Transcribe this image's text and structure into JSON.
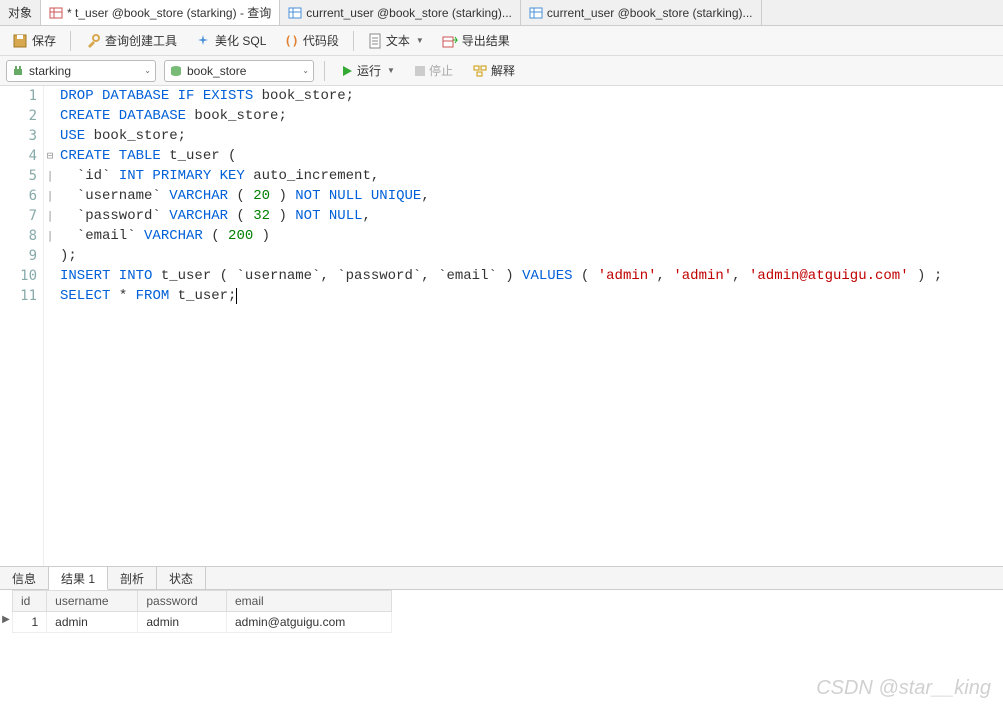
{
  "tabs": {
    "obj": "对象",
    "t0": "* t_user @book_store (starking) - 查询",
    "t1": "current_user @book_store (starking)...",
    "t2": "current_user @book_store (starking)..."
  },
  "toolbar": {
    "save": "保存",
    "query_builder": "查询创建工具",
    "beautify": "美化 SQL",
    "snippet": "代码段",
    "text": "文本",
    "export": "导出结果"
  },
  "combos": {
    "connection": "starking",
    "database": "book_store"
  },
  "run": {
    "run": "运行",
    "stop": "停止",
    "explain": "解释"
  },
  "code": {
    "lines": [
      {
        "n": "1",
        "t": [
          [
            "kw",
            "DROP DATABASE IF EXISTS"
          ],
          [
            "txt",
            " book_store;"
          ]
        ]
      },
      {
        "n": "2",
        "t": [
          [
            "kw",
            "CREATE DATABASE"
          ],
          [
            "txt",
            " book_store;"
          ]
        ]
      },
      {
        "n": "3",
        "t": [
          [
            "kw",
            "USE"
          ],
          [
            "txt",
            " book_store;"
          ]
        ]
      },
      {
        "n": "4",
        "fold": "⊟",
        "t": [
          [
            "kw",
            "CREATE TABLE"
          ],
          [
            "txt",
            " t_user ("
          ]
        ]
      },
      {
        "n": "5",
        "fold": "|",
        "t": [
          [
            "txt",
            "  `id` "
          ],
          [
            "kw",
            "INT PRIMARY KEY"
          ],
          [
            "txt",
            " auto_increment,"
          ]
        ]
      },
      {
        "n": "6",
        "fold": "|",
        "t": [
          [
            "txt",
            "  `username` "
          ],
          [
            "kw",
            "VARCHAR"
          ],
          [
            "txt",
            " ( "
          ],
          [
            "num",
            "20"
          ],
          [
            "txt",
            " ) "
          ],
          [
            "kw",
            "NOT NULL UNIQUE"
          ],
          [
            "txt",
            ","
          ]
        ]
      },
      {
        "n": "7",
        "fold": "|",
        "t": [
          [
            "txt",
            "  `password` "
          ],
          [
            "kw",
            "VARCHAR"
          ],
          [
            "txt",
            " ( "
          ],
          [
            "num",
            "32"
          ],
          [
            "txt",
            " ) "
          ],
          [
            "kw",
            "NOT NULL"
          ],
          [
            "txt",
            ","
          ]
        ]
      },
      {
        "n": "8",
        "fold": "|",
        "t": [
          [
            "txt",
            "  `email` "
          ],
          [
            "kw",
            "VARCHAR"
          ],
          [
            "txt",
            " ( "
          ],
          [
            "num",
            "200"
          ],
          [
            "txt",
            " )"
          ]
        ]
      },
      {
        "n": "9",
        "t": [
          [
            "txt",
            ");"
          ]
        ]
      },
      {
        "n": "10",
        "t": [
          [
            "kw",
            "INSERT INTO"
          ],
          [
            "txt",
            " t_user ( `username`, `password`, `email` ) "
          ],
          [
            "kw",
            "VALUES"
          ],
          [
            "txt",
            " ( "
          ],
          [
            "str",
            "'admin'"
          ],
          [
            "txt",
            ", "
          ],
          [
            "str",
            "'admin'"
          ],
          [
            "txt",
            ", "
          ],
          [
            "str",
            "'admin@atguigu.com'"
          ],
          [
            "txt",
            " ) ;"
          ]
        ]
      },
      {
        "n": "11",
        "t": [
          [
            "kw",
            "SELECT"
          ],
          [
            "txt",
            " * "
          ],
          [
            "kw",
            "FROM"
          ],
          [
            "txt",
            " t_user;"
          ]
        ],
        "cursor": true
      }
    ]
  },
  "bottom_tabs": {
    "info": "信息",
    "result": "结果 1",
    "profile": "剖析",
    "status": "状态"
  },
  "result_table": {
    "cols": [
      "id",
      "username",
      "password",
      "email"
    ],
    "rows": [
      {
        "id": "1",
        "username": "admin",
        "password": "admin",
        "email": "admin@atguigu.com"
      }
    ]
  },
  "watermark": "CSDN @star__king"
}
